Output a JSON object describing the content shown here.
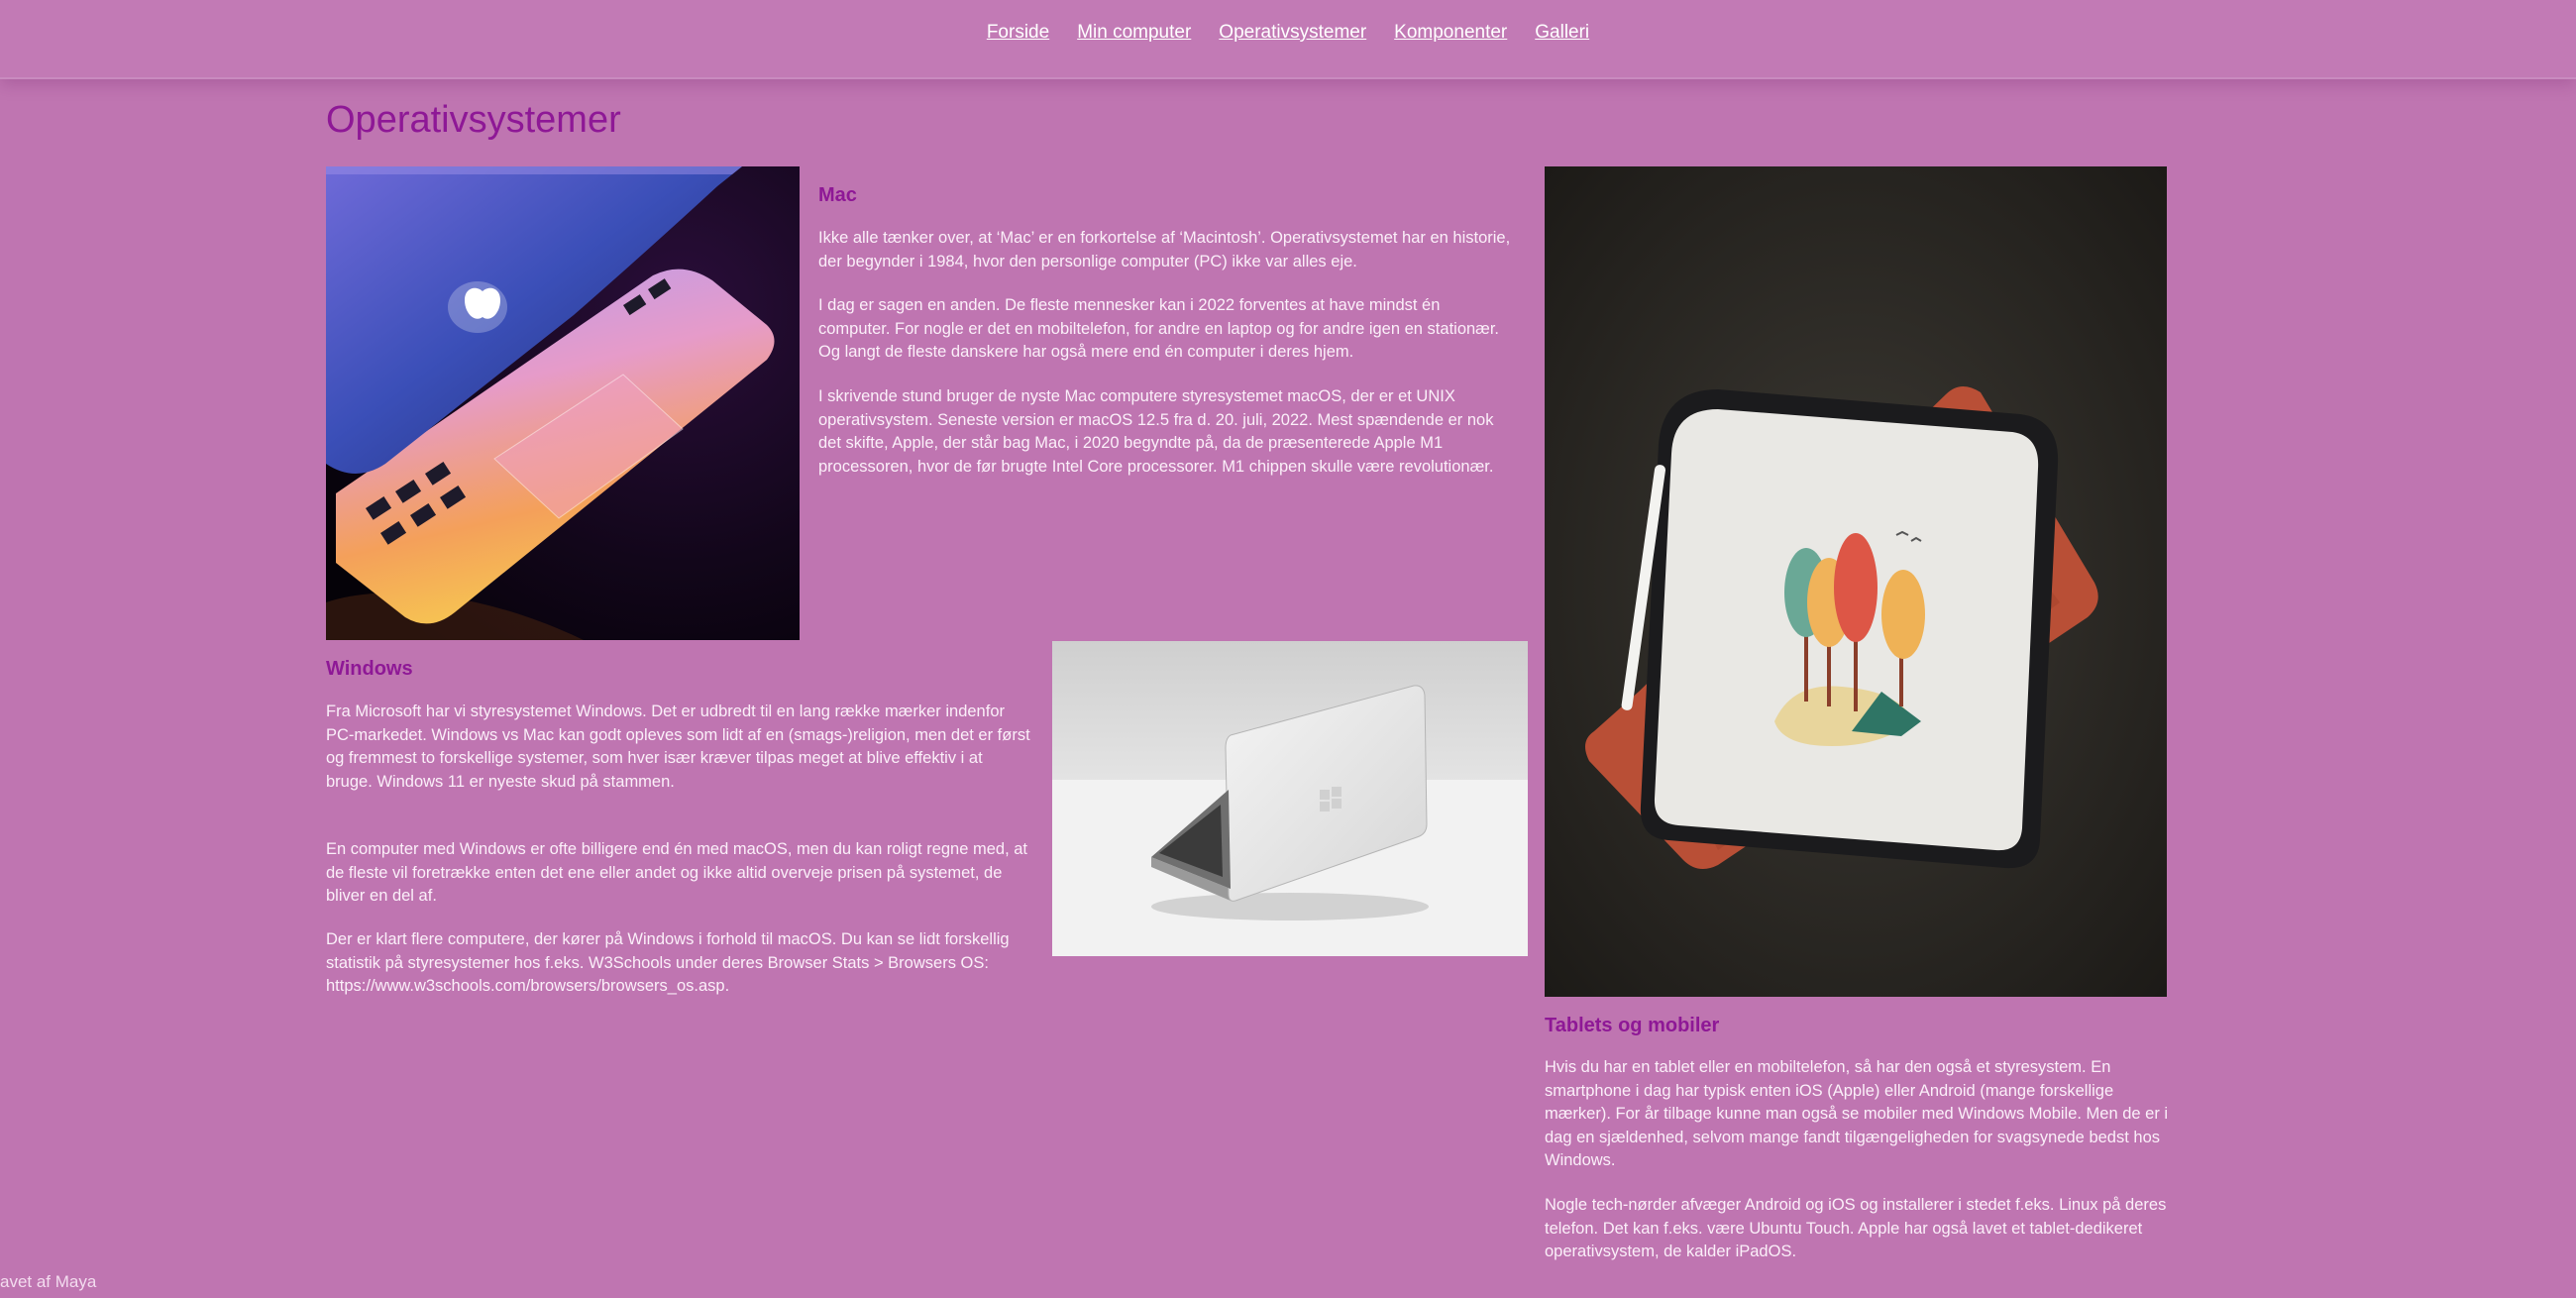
{
  "nav": {
    "items": [
      {
        "label": "Forside"
      },
      {
        "label": "Min computer"
      },
      {
        "label": "Operativsystemer"
      },
      {
        "label": "Komponenter"
      },
      {
        "label": "Galleri"
      }
    ]
  },
  "page": {
    "title": "Operativsystemer"
  },
  "mac": {
    "heading": "Mac",
    "paragraphs": [
      "Ikke alle tænker over, at ‘Mac’ er en forkortelse af ‘Macintosh’. Operativsystemet har en historie, der begynder i 1984, hvor den personlige computer (PC) ikke var alles eje.",
      "I dag er sagen en anden. De fleste mennesker kan i 2022 forventes at have mindst én computer. For nogle er det en mobiltelefon, for andre en laptop og for andre igen en stationær. Og langt de fleste danskere har også mere end én computer i deres hjem.",
      "I skrivende stund bruger de nyste Mac computere styresystemet macOS, der er et UNIX operativsystem. Seneste version er macOS 12.5 fra d. 20. juli, 2022. Mest spændende er nok det skifte, Apple, der står bag Mac, i 2020 begyndte på, da de præsenterede Apple M1 processoren, hvor de før brugte Intel Core processorer. M1 chippen skulle være revolutionær."
    ]
  },
  "windows": {
    "heading": "Windows",
    "paragraphs": [
      "Fra Microsoft har vi styresystemet Windows. Det er udbredt til en lang række mærker indenfor PC-markedet. Windows vs Mac kan godt opleves som lidt af en (smags-)religion, men det er først og fremmest to forskellige systemer, som hver især kræver tilpas meget at blive effektiv i at bruge. Windows 11 er nyeste skud på stammen.",
      "En computer med Windows er ofte billigere end én med macOS, men du kan roligt regne med, at de fleste vil foretrække enten det ene eller andet og ikke altid overveje prisen på systemet, de bliver en del af.",
      "Der er klart flere computere, der kører på Windows i forhold til macOS. Du kan se lidt forskellig statistik på styresystemer hos f.eks. W3Schools under deres Browser Stats > Browsers OS: https://www.w3schools.com/browsers/browsers_os.asp."
    ]
  },
  "tablets": {
    "heading": "Tablets og mobiler",
    "paragraphs": [
      "Hvis du har en tablet eller en mobiltelefon, så har den også et styresystem. En smartphone i dag har typisk enten iOS (Apple) eller Android (mange forskellige mærker). For år tilbage kunne man også se mobiler med Windows Mobile. Men de er i dag en sjældenhed, selvom mange fandt tilgængeligheden for svagsynede bedst hos Windows.",
      "Nogle tech-nørder afvæger Android og iOS og installerer i stedet f.eks. Linux på deres telefon. Det kan f.eks. være Ubuntu Touch. Apple har også lavet et tablet-dedikeret operativsystem, de kalder iPadOS."
    ]
  },
  "footer": {
    "credit": "avet af Maya"
  }
}
